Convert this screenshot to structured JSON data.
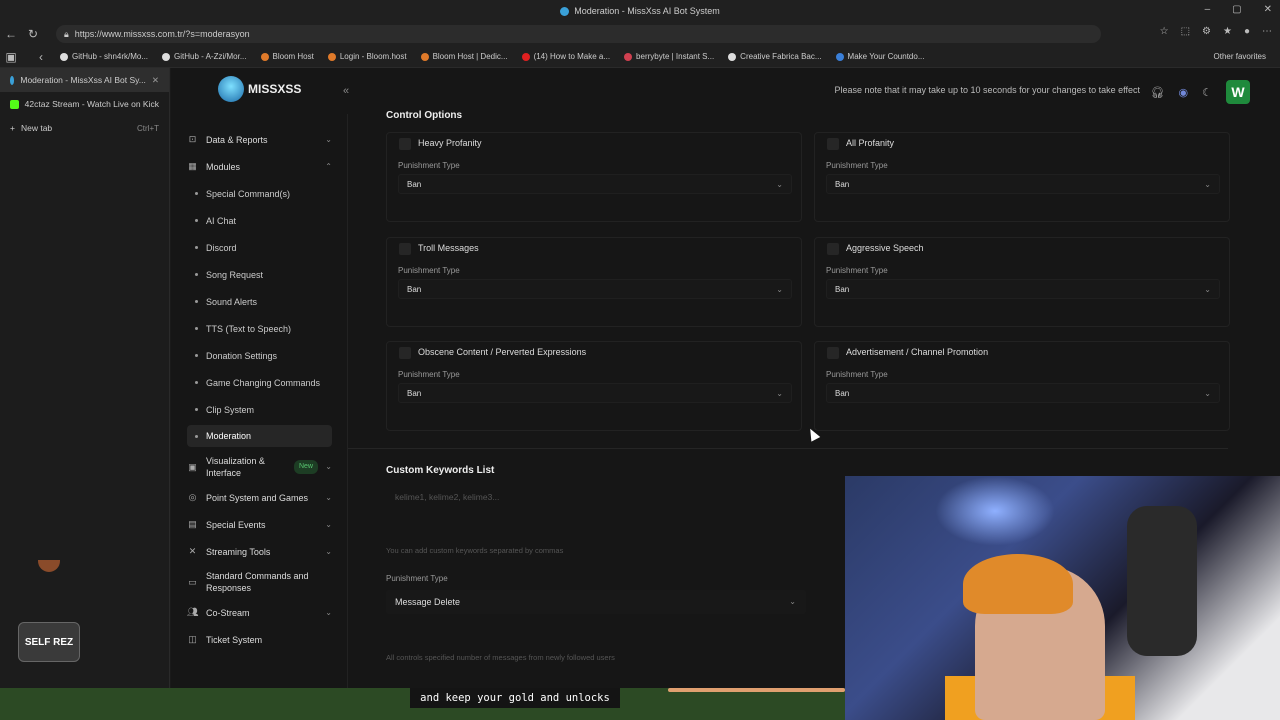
{
  "browser": {
    "window_title": "Moderation - MissXss AI Bot System",
    "url": "https://www.missxss.com.tr/?s=moderasyon",
    "bookmarks": [
      {
        "label": "GitHub - shn4rk/Mo...",
        "color": "#dddddd"
      },
      {
        "label": "GitHub - A-Zzi/Mor...",
        "color": "#dddddd"
      },
      {
        "label": "Bloom Host",
        "color": "#e07a2a"
      },
      {
        "label": "Login - Bloom.host",
        "color": "#e07a2a"
      },
      {
        "label": "Bloom Host | Dedic...",
        "color": "#e07a2a"
      },
      {
        "label": "(14) How to Make a...",
        "color": "#e02020"
      },
      {
        "label": "berrybyte | Instant S...",
        "color": "#d04050"
      },
      {
        "label": "Creative Fabrica Bac...",
        "color": "#dddddd"
      },
      {
        "label": "Make Your Countdo...",
        "color": "#3a7fd8"
      }
    ],
    "other_favorites": "Other favorites",
    "vertical_tabs": [
      {
        "label": "Moderation - MissXss AI Bot Sy...",
        "active": true,
        "icon": "missxss-favicon"
      },
      {
        "label": "42ctaz Stream - Watch Live on Kick",
        "active": false,
        "icon": "kick-favicon"
      },
      {
        "label": "New tab",
        "shortcut": "Ctrl+T",
        "icon": "plus-icon"
      }
    ]
  },
  "app": {
    "logo_text": "MISSXSS",
    "notice": "Please note that it may take up to 10 seconds for your changes to take effect",
    "avatar_letter": "W",
    "accent_green": "#1f8a3c"
  },
  "sidebar": {
    "top_items": [
      {
        "label": "Data & Reports",
        "icon": "chart-icon"
      },
      {
        "label": "Modules",
        "icon": "grid-icon"
      }
    ],
    "module_subitems": [
      "Special Command(s)",
      "AI Chat",
      "Discord",
      "Song Request",
      "Sound Alerts",
      "TTS (Text to Speech)",
      "Donation Settings",
      "Game Changing Commands",
      "Clip System",
      "Moderation"
    ],
    "bottom_items": [
      {
        "label": "Visualization & Interface",
        "badge": "New",
        "icon": "image-icon"
      },
      {
        "label": "Point System and Games",
        "icon": "coin-icon"
      },
      {
        "label": "Special Events",
        "icon": "calendar-icon"
      },
      {
        "label": "Streaming Tools",
        "icon": "tools-icon"
      },
      {
        "label": "Standard Commands and Responses",
        "icon": "terminal-icon"
      },
      {
        "label": "Co-Stream",
        "icon": "users-icon"
      },
      {
        "label": "Ticket System",
        "icon": "ticket-icon"
      }
    ]
  },
  "main": {
    "section_title": "Control Options",
    "punishment_label": "Punishment Type",
    "cards": [
      {
        "title": "Heavy Profanity",
        "value": "Ban"
      },
      {
        "title": "All Profanity",
        "value": "Ban"
      },
      {
        "title": "Troll Messages",
        "value": "Ban"
      },
      {
        "title": "Aggressive Speech",
        "value": "Ban"
      },
      {
        "title": "Obscene Content / Perverted Expressions",
        "value": "Ban"
      },
      {
        "title": "Advertisement / Channel Promotion",
        "value": "Ban"
      }
    ],
    "custom_keywords": {
      "title": "Custom Keywords List",
      "placeholder": "kelime1, kelime2, kelime3...",
      "help": "You can add custom keywords separated by commas",
      "punishment_label": "Punishment Type",
      "punishment_value": "Message Delete",
      "footer_note": "All controls specified number of messages from newly followed users"
    }
  },
  "overlay": {
    "logo_text": "SELF REZ",
    "subtitle": "and keep your gold and unlocks"
  }
}
